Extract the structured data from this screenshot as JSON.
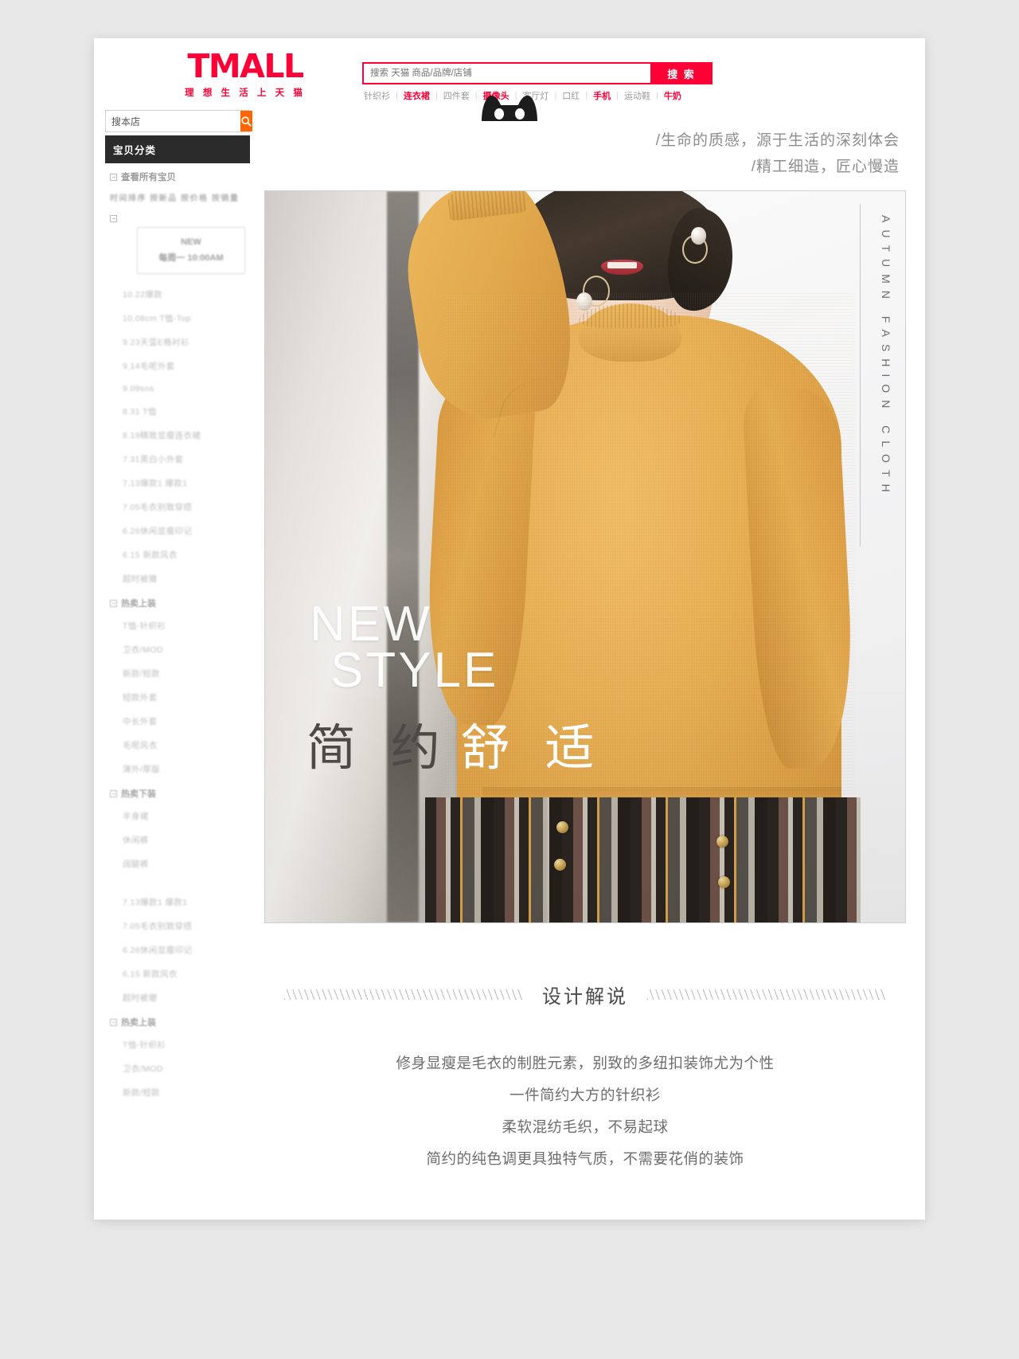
{
  "header": {
    "logo_text": "TMALL",
    "logo_slogan": "理 想 生 活 上 天 猫",
    "search_placeholder": "搜索 天猫 商品/品牌/店铺",
    "search_value": "",
    "search_button": "搜 索",
    "hotwords": [
      {
        "label": "针织衫",
        "hot": false
      },
      {
        "label": "连衣裙",
        "hot": true
      },
      {
        "label": "四件套",
        "hot": false
      },
      {
        "label": "摄像头",
        "hot": true
      },
      {
        "label": "客厅灯",
        "hot": false
      },
      {
        "label": "口红",
        "hot": false
      },
      {
        "label": "手机",
        "hot": true
      },
      {
        "label": "运动鞋",
        "hot": false
      },
      {
        "label": "牛奶",
        "hot": true
      }
    ]
  },
  "sidebar": {
    "store_search_value": "搜本店",
    "category_header": "宝贝分类",
    "view_all": "查看所有宝贝",
    "sort_row": "时间排序  按新品  按价格  按销量",
    "promo": {
      "line1": "NEW",
      "line2": "每周一 10:00AM"
    },
    "items_top": [
      "10.22爆款",
      "10.08cm T恤-Top",
      "9.23天蓝E格衬衫",
      "9.14毛呢外套",
      "9.09sns",
      "8.31 T恤",
      "8.19精致显瘦连衣裙",
      "7.31黑白小外套",
      "7.13爆款1 爆款1",
      "7.05毛衣别致穿搭",
      "6.26休闲显瘦印记",
      "6.15 新款风衣",
      "超时被撤"
    ],
    "group1_title": "热卖上装",
    "group1_items": [
      "T恤-针织衫",
      "卫衣/MOD",
      "新款/短款",
      "短款外套",
      "中长外套",
      "毛呢风衣",
      "薄外/厚版"
    ],
    "group2_title": "热卖下装",
    "group2_items": [
      "半身裙",
      "休闲裤",
      "阔腿裤"
    ],
    "items_mid": [
      "7.13爆款1 爆款1",
      "7.05毛衣别致穿搭",
      "6.26休闲显瘦印记",
      "6.15 新款风衣",
      "超时被撤"
    ],
    "group3_title": "热卖上装",
    "group3_items": [
      "T恤-针织衫",
      "卫衣/MOD",
      "新款/短款"
    ]
  },
  "main": {
    "slogan_line1": "/生命的质感，源于生活的深刻体会",
    "slogan_line2": "/精工细造，匠心慢造",
    "hero": {
      "vertical_text": "AUTUMN FASHION CLOTH",
      "new_style_line1": "NEW",
      "new_style_line2": "STYLE",
      "headline_dark": "简 约",
      "headline_light": "舒 适"
    },
    "design": {
      "title": "设计解说",
      "lines": [
        "修身显瘦是毛衣的制胜元素，别致的多纽扣装饰尤为个性",
        "一件简约大方的针织衫",
        "柔软混纺毛织，不易起球",
        "简约的纯色调更具独特气质，不需要花俏的装饰"
      ]
    }
  },
  "colors": {
    "brand_red": "#ff0036",
    "store_search_orange": "#f60",
    "category_header_bg": "#2b2b2b",
    "sweater_yellow": "#e8ae52"
  }
}
